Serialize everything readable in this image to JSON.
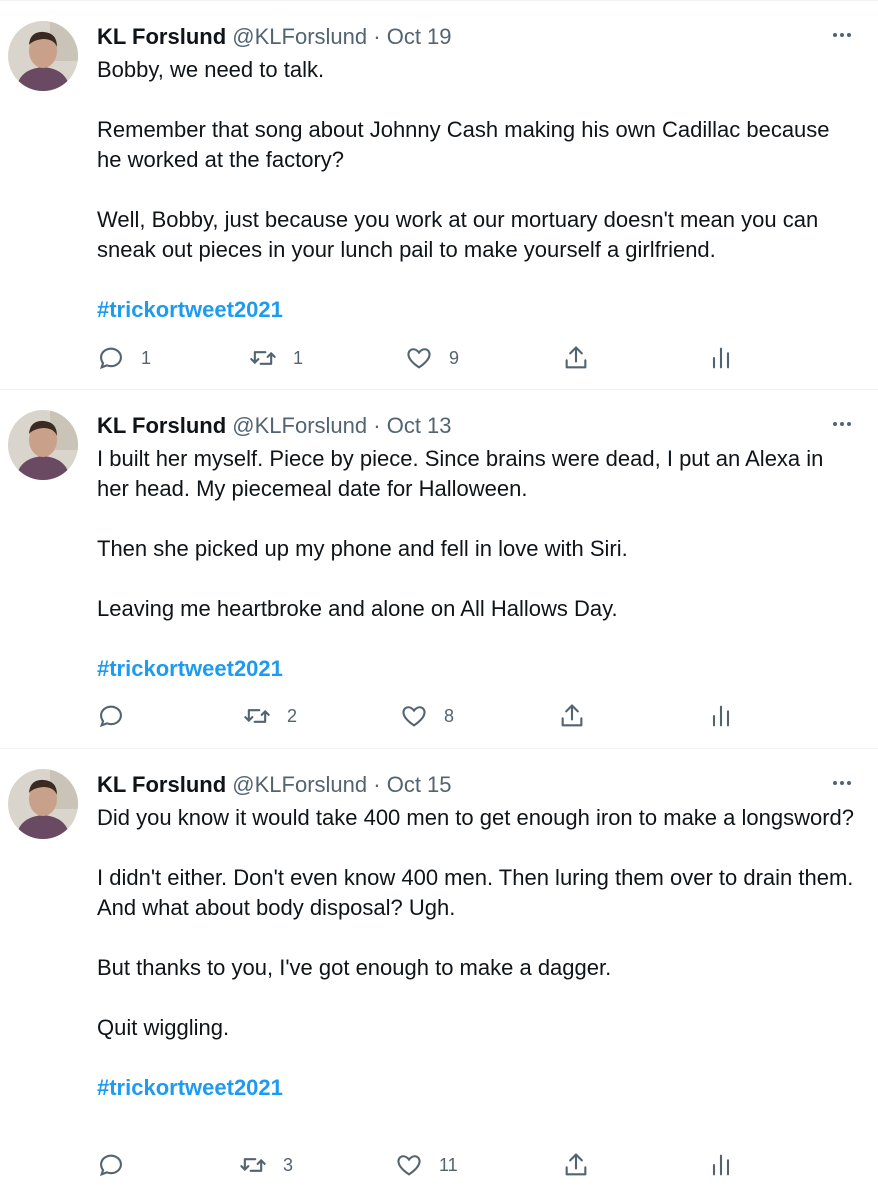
{
  "tweets": [
    {
      "author": "KL Forslund",
      "handle": "@KLForslund",
      "sep": "·",
      "date": "Oct 19",
      "paragraphs": [
        "Bobby, we need to talk.",
        "Remember that song about Johnny Cash making his own Cadillac because he worked at the factory?",
        "Well, Bobby, just because you work at our mortuary doesn't mean you can sneak out pieces in your lunch pail to make yourself a girlfriend."
      ],
      "hashtag": "#trickortweet2021",
      "replies": "1",
      "retweets": "1",
      "likes": "9"
    },
    {
      "author": "KL Forslund",
      "handle": "@KLForslund",
      "sep": "·",
      "date": "Oct 13",
      "paragraphs": [
        "I built her myself. Piece by piece. Since brains were dead, I put an Alexa in her head. My piecemeal date for Halloween.",
        "Then she picked up my phone and fell in love with Siri.",
        "Leaving me heartbroke and alone on All Hallows Day."
      ],
      "hashtag": "#trickortweet2021",
      "replies": "",
      "retweets": "2",
      "likes": "8"
    },
    {
      "author": "KL Forslund",
      "handle": "@KLForslund",
      "sep": "·",
      "date": "Oct 15",
      "paragraphs": [
        "Did you know it would take 400 men to get enough iron to make a longsword?",
        "I didn't either. Don't even know 400 men. Then luring them over to drain them.  And what about body disposal? Ugh.",
        "But thanks to you, I've got enough to make a dagger.",
        "Quit wiggling."
      ],
      "hashtag": "#trickortweet2021",
      "replies": "",
      "retweets": "3",
      "likes": "11"
    }
  ],
  "icons": {
    "reply": "reply-icon",
    "retweet": "retweet-icon",
    "like": "like-icon",
    "share": "share-icon",
    "analytics": "analytics-icon",
    "more": "more-icon"
  },
  "colors": {
    "text": "#0f1419",
    "muted": "#536471",
    "link": "#1d9bf0",
    "divider": "#eff3f4"
  }
}
